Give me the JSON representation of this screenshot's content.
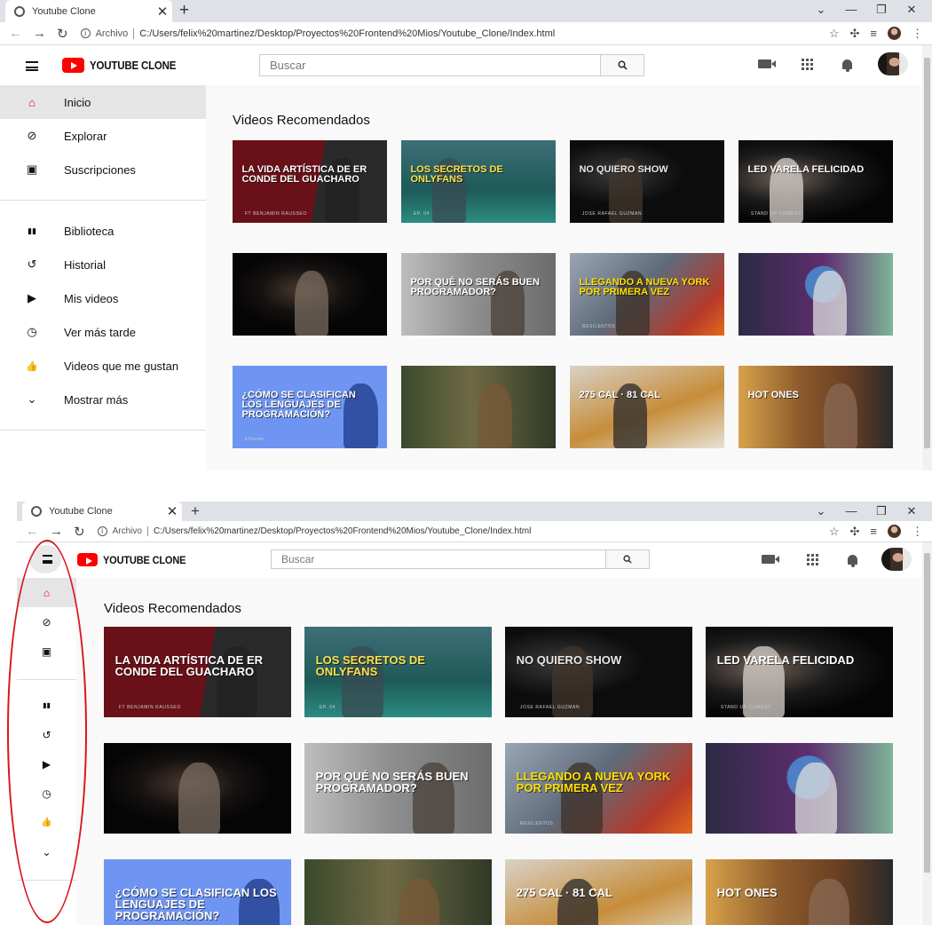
{
  "browser": {
    "tab_title": "Youtube Clone",
    "tab_close": "✕",
    "new_tab": "+",
    "scheme_label": "Archivo",
    "url": "C:/Users/felix%20martinez/Desktop/Proyectos%20Frontend%20Mios/Youtube_Clone/Index.html",
    "window_controls": [
      "⌄",
      "—",
      "❐",
      "✕"
    ]
  },
  "header": {
    "logo_text": "YOUTUBE CLONE",
    "search_placeholder": "Buscar"
  },
  "sidebar": {
    "primary": [
      {
        "label": "Inicio",
        "icon": "home-icon",
        "glyph": "⌂",
        "active": true
      },
      {
        "label": "Explorar",
        "icon": "compass-icon",
        "glyph": "⊘",
        "active": false
      },
      {
        "label": "Suscripciones",
        "icon": "subscriptions-icon",
        "glyph": "▣",
        "active": false
      }
    ],
    "secondary": [
      {
        "label": "Biblioteca",
        "icon": "library-icon",
        "glyph": "▮▮"
      },
      {
        "label": "Historial",
        "icon": "history-icon",
        "glyph": "↺"
      },
      {
        "label": "Mis videos",
        "icon": "play-icon",
        "glyph": "▶"
      },
      {
        "label": "Ver más tarde",
        "icon": "clock-icon",
        "glyph": "◷"
      },
      {
        "label": "Videos que me gustan",
        "icon": "thumbs-up-icon",
        "glyph": "👍"
      },
      {
        "label": "Mostrar más",
        "icon": "chevron-down-icon",
        "glyph": "⌄"
      }
    ]
  },
  "main": {
    "section_title": "Videos Recomendados",
    "videos": [
      {
        "theme": "t-guacharo",
        "caption": "La vida artística de er conde del guacharo",
        "sub": "FT BENJAMIN RAUSSEO",
        "accent": "#ffffff"
      },
      {
        "theme": "t-onlyfans",
        "caption": "Los secretos de ONLYFans",
        "sub": "EP. 04",
        "accent": "#ffe14a"
      },
      {
        "theme": "t-noquiero",
        "caption": "No quiero show",
        "sub": "JOSE RAFAEL GUZMAN",
        "accent": "#e8e8e8"
      },
      {
        "theme": "t-led",
        "caption": "Led Varela Felicidad",
        "sub": "STAND UP COMEDY",
        "accent": "#ffffff"
      },
      {
        "theme": "t-stage",
        "caption": "",
        "sub": "",
        "accent": "#ffffff"
      },
      {
        "theme": "t-porque",
        "caption": "Por qué no serás buen programador?",
        "sub": "",
        "accent": "#ffffff"
      },
      {
        "theme": "t-ny",
        "caption": "Llegando a Nueva York por primera vez",
        "sub": "RESILENTOS",
        "accent": "#ffe000"
      },
      {
        "theme": "t-philo",
        "caption": "",
        "sub": "",
        "accent": "#ffffff"
      },
      {
        "theme": "t-lang",
        "caption": "¿Cómo se clasifican los lenguajes de programación?",
        "sub": "EDteam",
        "accent": "#ffffff"
      },
      {
        "theme": "t-jungle",
        "caption": "",
        "sub": "",
        "accent": "#ffffff"
      },
      {
        "theme": "t-food",
        "caption": "275 CAL · 81 CAL",
        "sub": "",
        "accent": "#ffffff"
      },
      {
        "theme": "t-hot",
        "caption": "Hot Ones",
        "sub": "",
        "accent": "#ffffff"
      }
    ]
  },
  "colors": {
    "brand_red": "#ff0000",
    "annotation_red": "#d8171f",
    "sidebar_active_bg": "#e5e5e5",
    "content_bg": "#f9f9f9"
  }
}
